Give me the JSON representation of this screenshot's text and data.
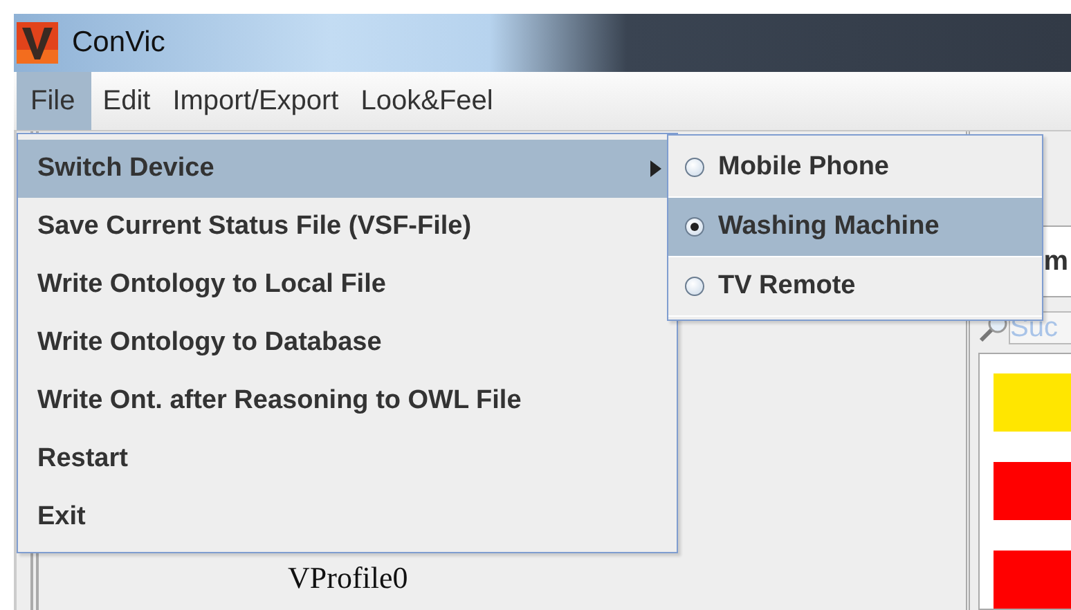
{
  "window": {
    "title": "ConVic"
  },
  "menubar": [
    {
      "label": "File",
      "selected": true
    },
    {
      "label": "Edit",
      "selected": false
    },
    {
      "label": "Import/Export",
      "selected": false
    },
    {
      "label": "Look&Feel",
      "selected": false
    }
  ],
  "file_menu": [
    {
      "label": "Switch Device",
      "kind": "submenu",
      "selected": true
    },
    {
      "label": "Save Current Status File (VSF-File)",
      "kind": "item",
      "selected": false
    },
    {
      "label": "Write Ontology to Local File",
      "kind": "item",
      "selected": false
    },
    {
      "label": "Write Ontology to Database",
      "kind": "item",
      "selected": false
    },
    {
      "label": "Write Ont. after Reasoning to OWL File",
      "kind": "item",
      "selected": false
    },
    {
      "label": "Restart",
      "kind": "item",
      "selected": false
    },
    {
      "label": "Exit",
      "kind": "item",
      "selected": false
    }
  ],
  "switch_device_submenu": [
    {
      "label": "Mobile Phone",
      "checked": false,
      "selected": false
    },
    {
      "label": "Washing Machine",
      "checked": true,
      "selected": true
    },
    {
      "label": "TV Remote",
      "checked": false,
      "selected": false
    }
  ],
  "background": {
    "panel_label": "m",
    "search": {
      "placeholder": "Suc"
    },
    "bars": [
      {
        "color": "#ffe600"
      },
      {
        "color": "#ff0000"
      },
      {
        "color": "#ff0000"
      }
    ],
    "profile_label": "VProfile0"
  }
}
